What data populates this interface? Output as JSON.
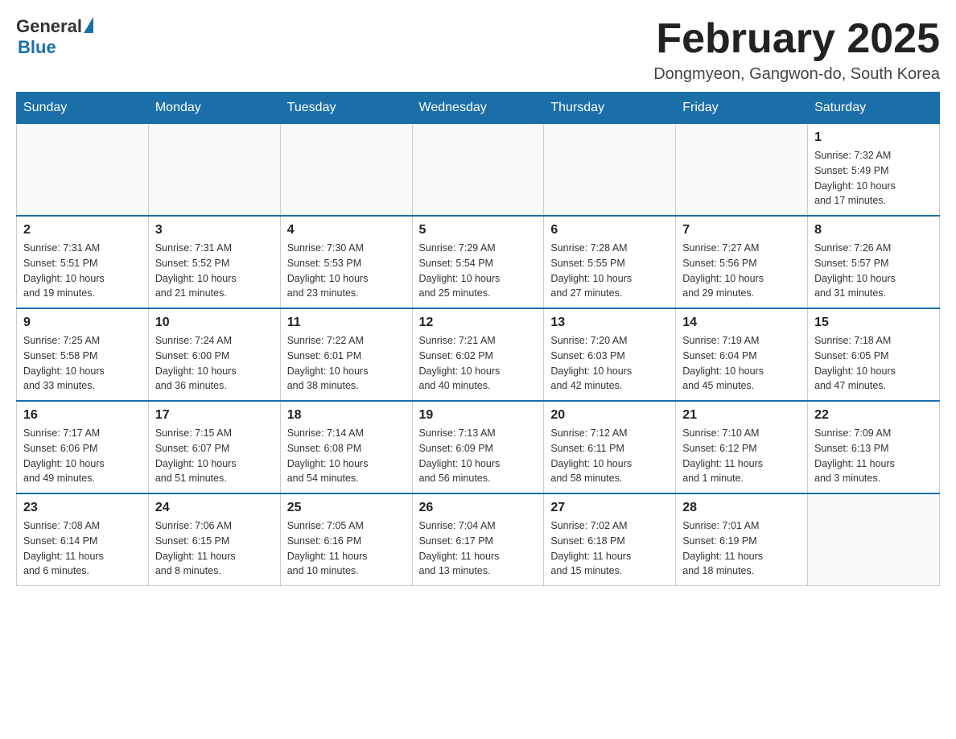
{
  "header": {
    "logo_general": "General",
    "logo_blue": "Blue",
    "month_title": "February 2025",
    "location": "Dongmyeon, Gangwon-do, South Korea"
  },
  "days_of_week": [
    "Sunday",
    "Monday",
    "Tuesday",
    "Wednesday",
    "Thursday",
    "Friday",
    "Saturday"
  ],
  "weeks": [
    [
      {
        "day": "",
        "info": ""
      },
      {
        "day": "",
        "info": ""
      },
      {
        "day": "",
        "info": ""
      },
      {
        "day": "",
        "info": ""
      },
      {
        "day": "",
        "info": ""
      },
      {
        "day": "",
        "info": ""
      },
      {
        "day": "1",
        "info": "Sunrise: 7:32 AM\nSunset: 5:49 PM\nDaylight: 10 hours\nand 17 minutes."
      }
    ],
    [
      {
        "day": "2",
        "info": "Sunrise: 7:31 AM\nSunset: 5:51 PM\nDaylight: 10 hours\nand 19 minutes."
      },
      {
        "day": "3",
        "info": "Sunrise: 7:31 AM\nSunset: 5:52 PM\nDaylight: 10 hours\nand 21 minutes."
      },
      {
        "day": "4",
        "info": "Sunrise: 7:30 AM\nSunset: 5:53 PM\nDaylight: 10 hours\nand 23 minutes."
      },
      {
        "day": "5",
        "info": "Sunrise: 7:29 AM\nSunset: 5:54 PM\nDaylight: 10 hours\nand 25 minutes."
      },
      {
        "day": "6",
        "info": "Sunrise: 7:28 AM\nSunset: 5:55 PM\nDaylight: 10 hours\nand 27 minutes."
      },
      {
        "day": "7",
        "info": "Sunrise: 7:27 AM\nSunset: 5:56 PM\nDaylight: 10 hours\nand 29 minutes."
      },
      {
        "day": "8",
        "info": "Sunrise: 7:26 AM\nSunset: 5:57 PM\nDaylight: 10 hours\nand 31 minutes."
      }
    ],
    [
      {
        "day": "9",
        "info": "Sunrise: 7:25 AM\nSunset: 5:58 PM\nDaylight: 10 hours\nand 33 minutes."
      },
      {
        "day": "10",
        "info": "Sunrise: 7:24 AM\nSunset: 6:00 PM\nDaylight: 10 hours\nand 36 minutes."
      },
      {
        "day": "11",
        "info": "Sunrise: 7:22 AM\nSunset: 6:01 PM\nDaylight: 10 hours\nand 38 minutes."
      },
      {
        "day": "12",
        "info": "Sunrise: 7:21 AM\nSunset: 6:02 PM\nDaylight: 10 hours\nand 40 minutes."
      },
      {
        "day": "13",
        "info": "Sunrise: 7:20 AM\nSunset: 6:03 PM\nDaylight: 10 hours\nand 42 minutes."
      },
      {
        "day": "14",
        "info": "Sunrise: 7:19 AM\nSunset: 6:04 PM\nDaylight: 10 hours\nand 45 minutes."
      },
      {
        "day": "15",
        "info": "Sunrise: 7:18 AM\nSunset: 6:05 PM\nDaylight: 10 hours\nand 47 minutes."
      }
    ],
    [
      {
        "day": "16",
        "info": "Sunrise: 7:17 AM\nSunset: 6:06 PM\nDaylight: 10 hours\nand 49 minutes."
      },
      {
        "day": "17",
        "info": "Sunrise: 7:15 AM\nSunset: 6:07 PM\nDaylight: 10 hours\nand 51 minutes."
      },
      {
        "day": "18",
        "info": "Sunrise: 7:14 AM\nSunset: 6:08 PM\nDaylight: 10 hours\nand 54 minutes."
      },
      {
        "day": "19",
        "info": "Sunrise: 7:13 AM\nSunset: 6:09 PM\nDaylight: 10 hours\nand 56 minutes."
      },
      {
        "day": "20",
        "info": "Sunrise: 7:12 AM\nSunset: 6:11 PM\nDaylight: 10 hours\nand 58 minutes."
      },
      {
        "day": "21",
        "info": "Sunrise: 7:10 AM\nSunset: 6:12 PM\nDaylight: 11 hours\nand 1 minute."
      },
      {
        "day": "22",
        "info": "Sunrise: 7:09 AM\nSunset: 6:13 PM\nDaylight: 11 hours\nand 3 minutes."
      }
    ],
    [
      {
        "day": "23",
        "info": "Sunrise: 7:08 AM\nSunset: 6:14 PM\nDaylight: 11 hours\nand 6 minutes."
      },
      {
        "day": "24",
        "info": "Sunrise: 7:06 AM\nSunset: 6:15 PM\nDaylight: 11 hours\nand 8 minutes."
      },
      {
        "day": "25",
        "info": "Sunrise: 7:05 AM\nSunset: 6:16 PM\nDaylight: 11 hours\nand 10 minutes."
      },
      {
        "day": "26",
        "info": "Sunrise: 7:04 AM\nSunset: 6:17 PM\nDaylight: 11 hours\nand 13 minutes."
      },
      {
        "day": "27",
        "info": "Sunrise: 7:02 AM\nSunset: 6:18 PM\nDaylight: 11 hours\nand 15 minutes."
      },
      {
        "day": "28",
        "info": "Sunrise: 7:01 AM\nSunset: 6:19 PM\nDaylight: 11 hours\nand 18 minutes."
      },
      {
        "day": "",
        "info": ""
      }
    ]
  ]
}
